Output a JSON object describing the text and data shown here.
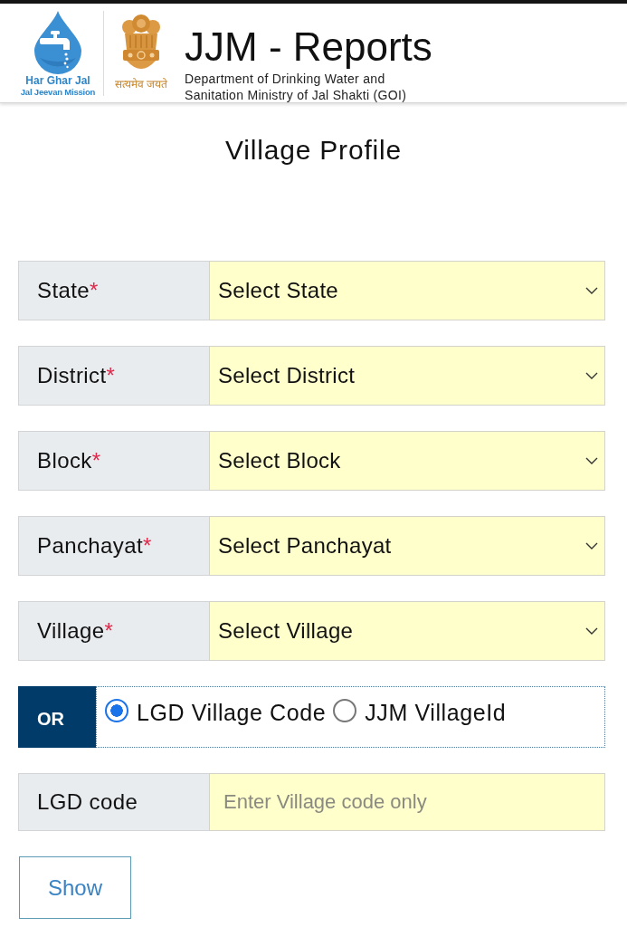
{
  "header": {
    "logo_title": "Har Ghar Jal",
    "logo_subtitle": "Jal Jeevan Mission",
    "emblem_motto": "सत्यमेव जयते",
    "title": "JJM - Reports",
    "subtitle": "Department of Drinking Water and Sanitation Ministry of Jal Shakti (GOI)"
  },
  "page_title": "Village Profile",
  "selects": [
    {
      "label": "State",
      "required_mark": "*",
      "value": "Select State"
    },
    {
      "label": "District",
      "required_mark": "*",
      "value": "Select District"
    },
    {
      "label": "Block",
      "required_mark": "*",
      "value": "Select Block"
    },
    {
      "label": "Panchayat",
      "required_mark": "*",
      "value": "Select Panchayat"
    },
    {
      "label": "Village",
      "required_mark": "*",
      "value": "Select Village"
    }
  ],
  "or_row": {
    "badge": "OR",
    "options": [
      {
        "label": "LGD Village Code",
        "selected": true
      },
      {
        "label": "JJM VillageId",
        "selected": false
      }
    ]
  },
  "code_field": {
    "label": "LGD code",
    "placeholder": "Enter Village code only"
  },
  "show_button": "Show"
}
